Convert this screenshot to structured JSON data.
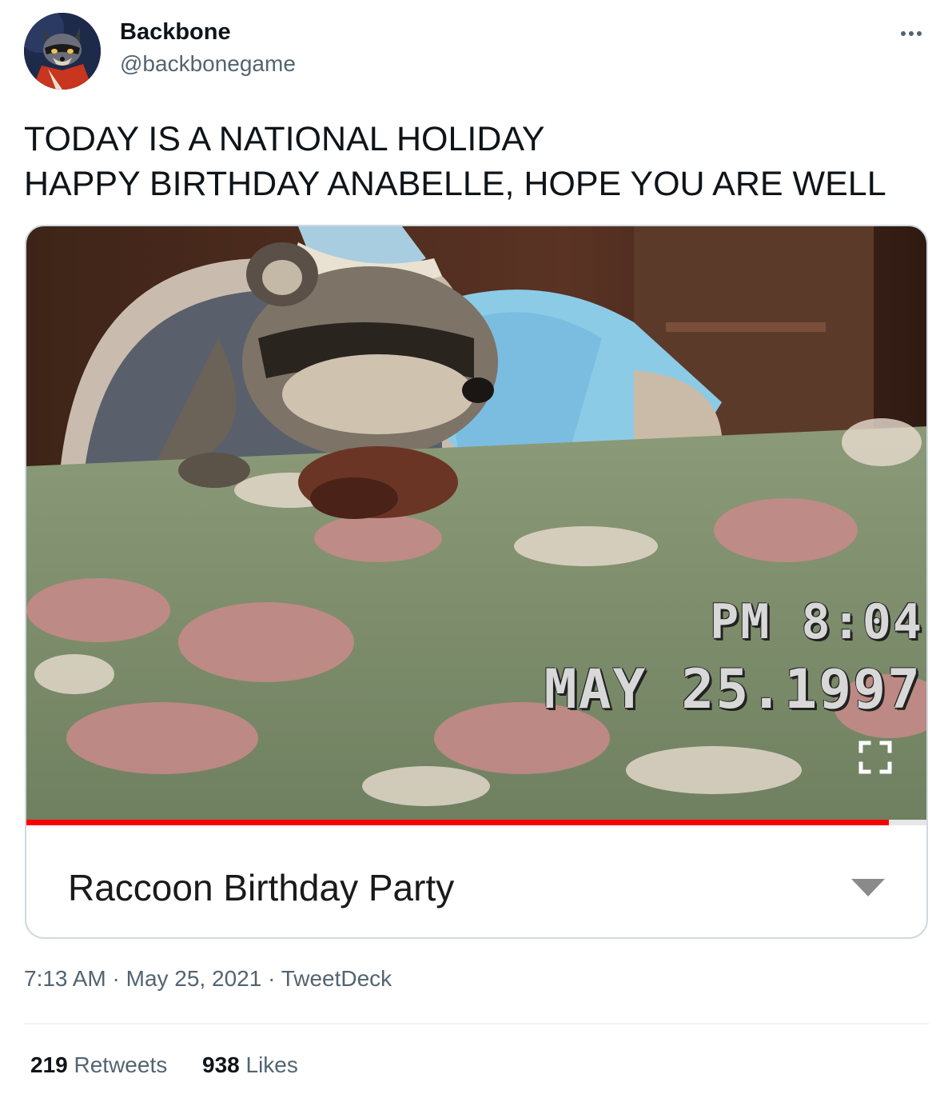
{
  "author": {
    "display_name": "Backbone",
    "handle": "@backbonegame",
    "avatar_icon": "raccoon-avatar-icon"
  },
  "tweet": {
    "text_line_1": "TODAY IS A NATIONAL HOLIDAY",
    "text_line_2": "HAPPY BIRTHDAY ANABELLE, HOPE YOU ARE WELL"
  },
  "media": {
    "vcr_time": "PM  8:04",
    "vcr_date": "MAY 25.1997",
    "title": "Raccoon Birthday Party",
    "progress_fraction": 0.955,
    "progress_color": "#ff0000"
  },
  "meta": {
    "time": "7:13 AM",
    "date": "May 25, 2021",
    "source": "TweetDeck",
    "separator": "·"
  },
  "stats": {
    "retweets_count": "219",
    "retweets_label": "Retweets",
    "likes_count": "938",
    "likes_label": "Likes"
  }
}
